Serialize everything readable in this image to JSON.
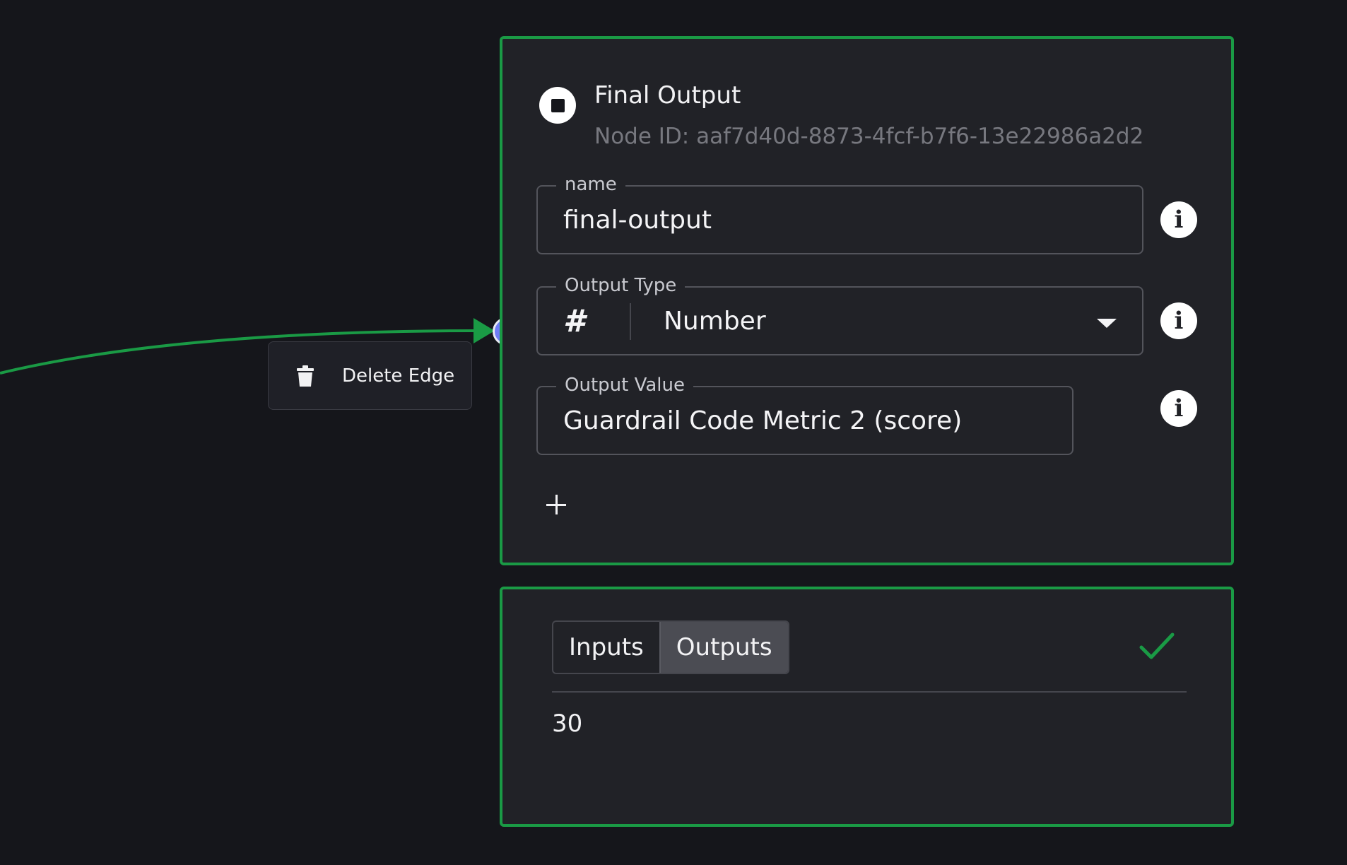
{
  "edge_menu": {
    "delete_label": "Delete Edge"
  },
  "node": {
    "title": "Final Output",
    "node_id": "Node ID: aaf7d40d-8873-4fcf-b7f6-13e22986a2d2",
    "fields": {
      "name": {
        "label": "name",
        "value": "final-output"
      },
      "output_type": {
        "label": "Output Type",
        "type_symbol": "#",
        "value": "Number"
      },
      "output_value": {
        "label": "Output Value",
        "value": "Guardrail Code Metric 2 (score)"
      }
    },
    "info_icon": "i",
    "icons": [
      "stop-icon",
      "info-icon",
      "plus-icon",
      "chevron-down-icon"
    ]
  },
  "results": {
    "tabs": [
      {
        "label": "Inputs",
        "active": false
      },
      {
        "label": "Outputs",
        "active": true
      }
    ],
    "status_icon": "check-icon",
    "output_value": "30"
  },
  "colors": {
    "accent_green": "#1a9a45",
    "handle_blue": "#6f7cf6",
    "background": "#15161b",
    "panel": "#212227"
  }
}
